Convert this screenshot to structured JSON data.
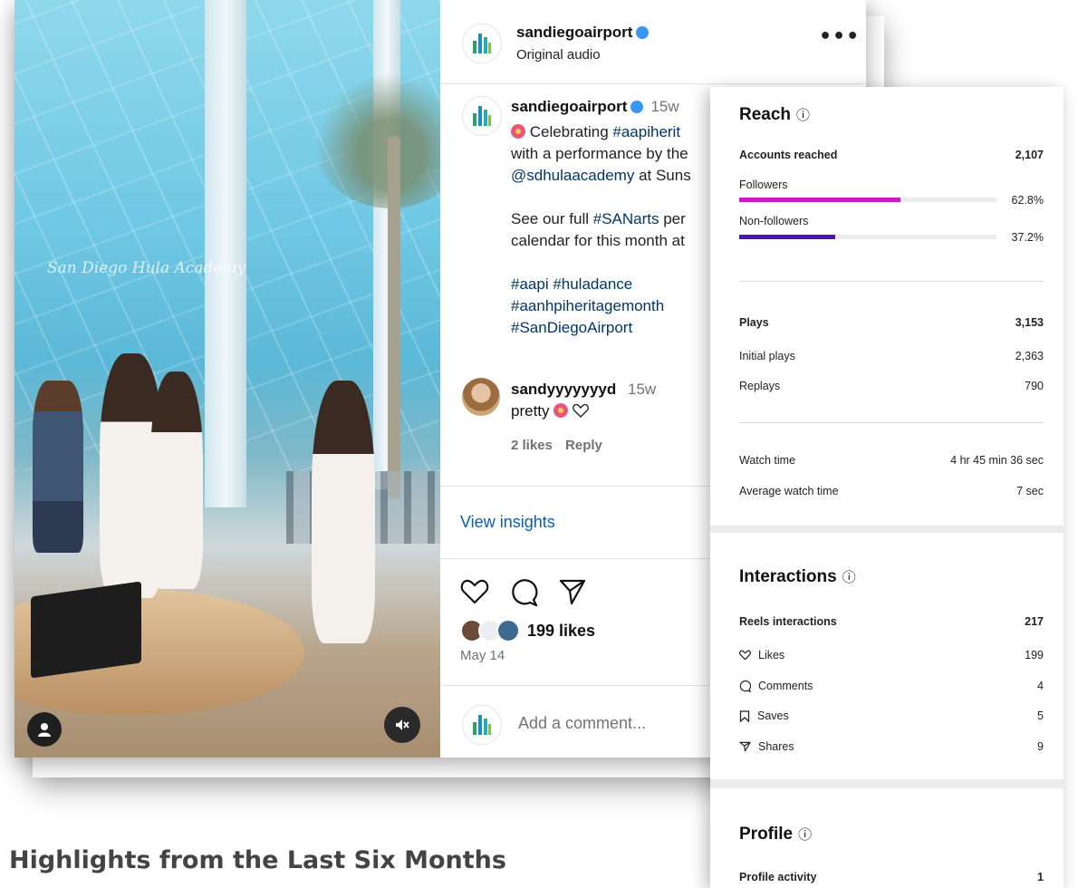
{
  "video": {
    "watermark": "San Diego Hula Academy"
  },
  "post": {
    "account": "sandiegoairport",
    "audio": "Original audio",
    "more_label": "•••",
    "caption": {
      "account": "sandiegoairport",
      "time": "15w",
      "line1_prefix": " Celebrating ",
      "line1_tag": "#aapiherit",
      "line2": "with a performance by the",
      "line3_tag": "@sdhulaacademy",
      "line3_rest": " at Suns",
      "line4_prefix": "See our full ",
      "line4_tag": "#SANarts",
      "line4_rest": " per",
      "line5": "calendar for this month at",
      "tags_line1": "#aapi #huladance",
      "tags_line2": "#aanhpiheritagemonth",
      "tags_line3": "#SanDiegoAirport"
    },
    "comment": {
      "user": "sandyyyyyyyd",
      "time": "15w",
      "text": "pretty",
      "likes": "2 likes",
      "reply": "Reply"
    },
    "view_insights": "View insights",
    "likes": "199 likes",
    "date": "May 14",
    "add_comment": "Add a comment..."
  },
  "insights": {
    "reach": {
      "title": "Reach",
      "info": "ⓘ",
      "accounts_reached_label": "Accounts reached",
      "accounts_reached": "2,107",
      "followers_label": "Followers",
      "followers_pct": "62.8%",
      "followers_fraction": 0.628,
      "nonfollowers_label": "Non-followers",
      "nonfollowers_pct": "37.2%",
      "nonfollowers_fraction": 0.372
    },
    "plays": {
      "plays_label": "Plays",
      "plays": "3,153",
      "initial_label": "Initial plays",
      "initial": "2,363",
      "replays_label": "Replays",
      "replays": "790",
      "watch_label": "Watch time",
      "watch": "4 hr 45 min 36 sec",
      "avg_label": "Average watch time",
      "avg": "7 sec"
    },
    "interactions": {
      "title": "Interactions",
      "info": "ⓘ",
      "reels_label": "Reels interactions",
      "reels": "217",
      "likes_label": "Likes",
      "likes": "199",
      "comments_label": "Comments",
      "comments": "4",
      "saves_label": "Saves",
      "saves": "5",
      "shares_label": "Shares",
      "shares": "9"
    },
    "profile": {
      "title": "Profile",
      "info": "ⓘ",
      "activity_label": "Profile activity",
      "activity": "1"
    }
  },
  "footer": {
    "title": "Highlights from the Last Six Months"
  },
  "colors": {
    "followers_bar": "#c81bc3",
    "nonfollowers_bar": "#4a16b5",
    "link": "#00376b",
    "view_insights": "#0a5faa"
  }
}
